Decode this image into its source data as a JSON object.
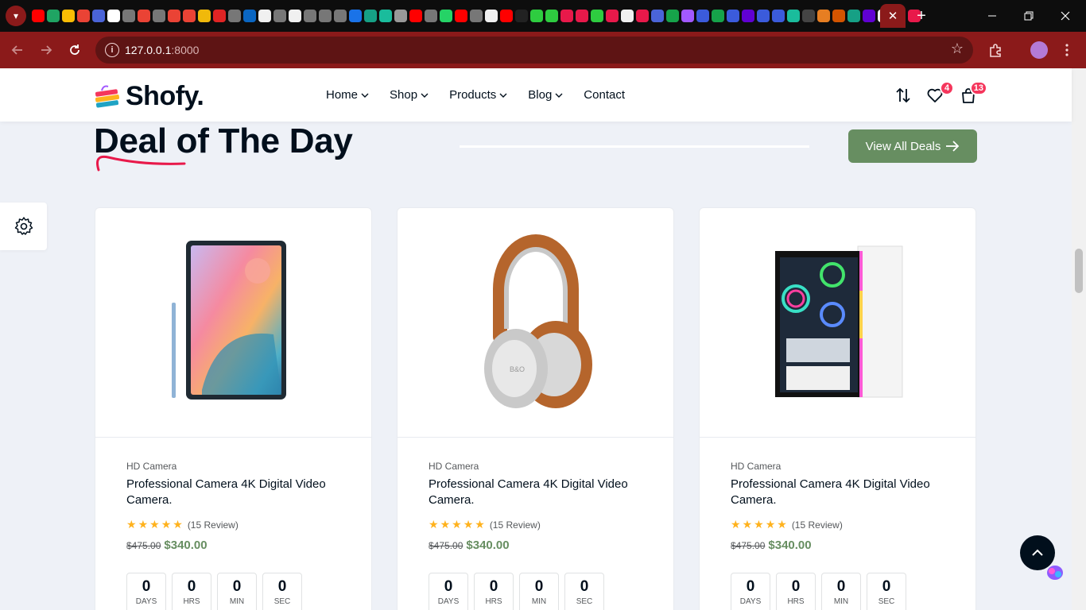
{
  "browser": {
    "url_host": "127.0.0.1",
    "url_port": ":8000",
    "active_tab_close": "✕",
    "new_tab": "+",
    "icons": [
      "tab-search-icon",
      "back-icon",
      "forward-icon",
      "reload-icon",
      "info-icon",
      "bookmark-star-icon",
      "extensions-icon",
      "profile-avatar",
      "minimize-icon",
      "restore-icon",
      "window-close-icon"
    ]
  },
  "header": {
    "logo_text": "Shofy.",
    "nav": [
      {
        "label": "Home"
      },
      {
        "label": "Shop"
      },
      {
        "label": "Products"
      },
      {
        "label": "Blog"
      },
      {
        "label": "Contact"
      }
    ],
    "wishlist_count": "4",
    "cart_count": "13"
  },
  "section": {
    "title": "Deal of The Day",
    "view_all_label": "View All Deals"
  },
  "products": [
    {
      "image": "tablet",
      "category": "HD Camera",
      "title": "Professional Camera 4K Digital Video Camera.",
      "rating_stars": 5,
      "reviews": "(15 Review)",
      "old_price": "$475.00",
      "new_price": "$340.00",
      "countdown": [
        {
          "value": "0",
          "label": "DAYS"
        },
        {
          "value": "0",
          "label": "HRS"
        },
        {
          "value": "0",
          "label": "MIN"
        },
        {
          "value": "0",
          "label": "SEC"
        }
      ]
    },
    {
      "image": "headphones",
      "category": "HD Camera",
      "title": "Professional Camera 4K Digital Video Camera.",
      "rating_stars": 5,
      "reviews": "(15 Review)",
      "old_price": "$475.00",
      "new_price": "$340.00",
      "countdown": [
        {
          "value": "0",
          "label": "DAYS"
        },
        {
          "value": "0",
          "label": "HRS"
        },
        {
          "value": "0",
          "label": "MIN"
        },
        {
          "value": "0",
          "label": "SEC"
        }
      ]
    },
    {
      "image": "pc-case",
      "category": "HD Camera",
      "title": "Professional Camera 4K Digital Video Camera.",
      "rating_stars": 5,
      "reviews": "(15 Review)",
      "old_price": "$475.00",
      "new_price": "$340.00",
      "countdown": [
        {
          "value": "0",
          "label": "DAYS"
        },
        {
          "value": "0",
          "label": "HRS"
        },
        {
          "value": "0",
          "label": "MIN"
        },
        {
          "value": "0",
          "label": "SEC"
        }
      ]
    }
  ],
  "colors": {
    "accent_green": "#678e61",
    "badge_red": "#f5365c",
    "dark": "#010f1c",
    "browser_red": "#8b1a1a"
  }
}
